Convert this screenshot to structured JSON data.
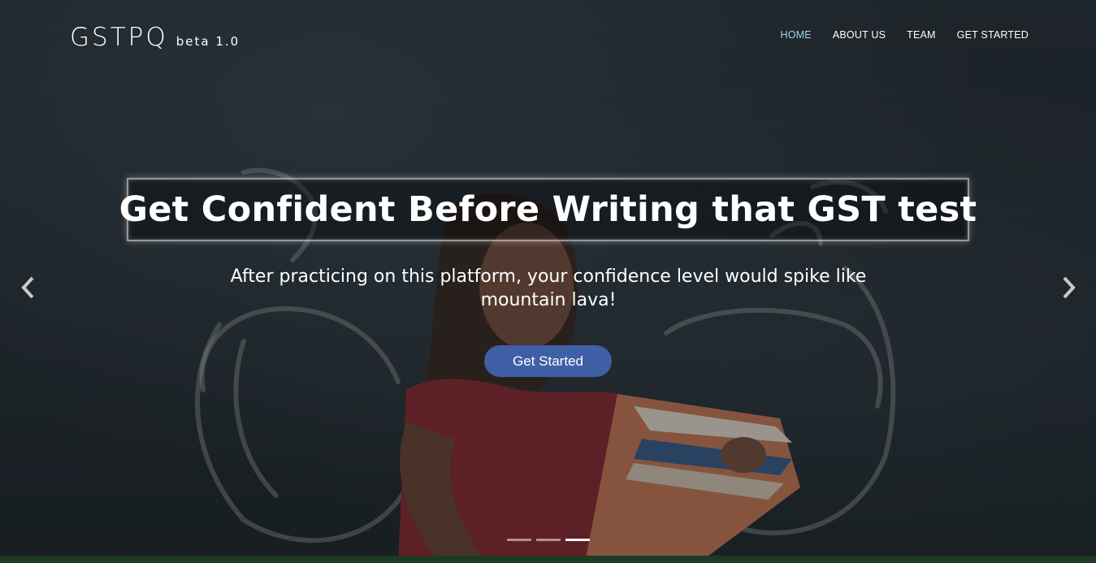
{
  "brand": {
    "name": "GSTPQ",
    "version": "beta 1.0"
  },
  "nav": {
    "items": [
      {
        "label": "HOME",
        "active": true
      },
      {
        "label": "ABOUT US",
        "active": false
      },
      {
        "label": "TEAM",
        "active": false
      },
      {
        "label": "GET STARTED",
        "active": false
      }
    ],
    "active_color": "#9ad2ee"
  },
  "hero": {
    "headline": "Get Confident Before Writing that GST test",
    "subtitle_line1": "After practicing on this platform, your confidence level would spike like",
    "subtitle_line2": "mountain lava!",
    "cta_label": "Get Started",
    "cta_color": "#3f5fa6"
  },
  "carousel": {
    "prev_icon": "chevron-left-icon",
    "next_icon": "chevron-right-icon",
    "slide_count": 3,
    "active_slide": 3
  }
}
